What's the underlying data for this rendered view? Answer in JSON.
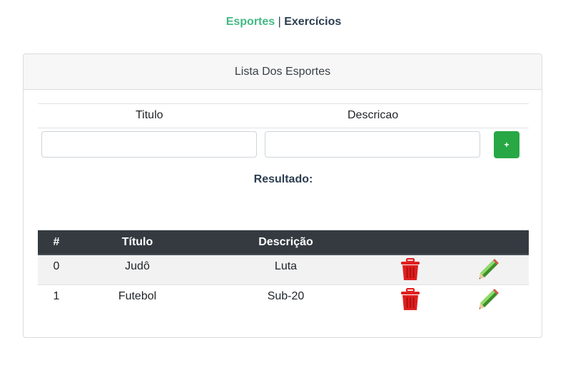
{
  "nav": {
    "active_label": "Esportes",
    "separator": "|",
    "other_label": "Exercícios"
  },
  "card": {
    "header": "Lista Dos Esportes"
  },
  "form": {
    "col_titulo": "Titulo",
    "col_descricao": "Descricao",
    "titulo_value": "",
    "descricao_value": "",
    "add_button_label": "+"
  },
  "result_label": "Resultado:",
  "table": {
    "headers": [
      "#",
      "Título",
      "Descrição",
      "",
      ""
    ],
    "rows": [
      {
        "index": "0",
        "titulo": "Judô",
        "descricao": "Luta"
      },
      {
        "index": "1",
        "titulo": "Futebol",
        "descricao": "Sub-20"
      }
    ]
  },
  "icons": {
    "delete": "trash-icon",
    "edit": "pencil-icon"
  },
  "colors": {
    "nav_active": "#42b983",
    "add_button": "#28a745",
    "table_header": "#343a40",
    "trash": "#e02020"
  }
}
